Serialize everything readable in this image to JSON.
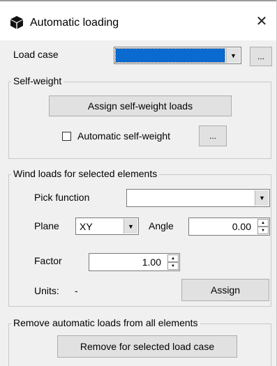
{
  "window": {
    "title": "Automatic loading",
    "icon": "cube-icon",
    "close_glyph": "✕"
  },
  "load_case": {
    "label": "Load case",
    "value": "",
    "more_label": "..."
  },
  "self_weight": {
    "legend": "Self-weight",
    "assign_button": "Assign self-weight loads",
    "auto_label": "Automatic self-weight",
    "auto_checked": false,
    "more_label": "..."
  },
  "wind": {
    "legend": "Wind loads for selected elements",
    "pick_label": "Pick function",
    "pick_value": "",
    "plane_label": "Plane",
    "plane_value": "XY",
    "angle_label": "Angle",
    "angle_value": "0.00",
    "factor_label": "Factor",
    "factor_value": "1.00",
    "units_label": "Units:",
    "units_value": "-",
    "assign_button": "Assign"
  },
  "remove": {
    "legend": "Remove automatic loads from all elements",
    "button": "Remove for selected load case"
  },
  "colors": {
    "selection": "#0a6ad0",
    "dialog_bg": "#f0f0f0",
    "button_bg": "#e1e1e1"
  }
}
